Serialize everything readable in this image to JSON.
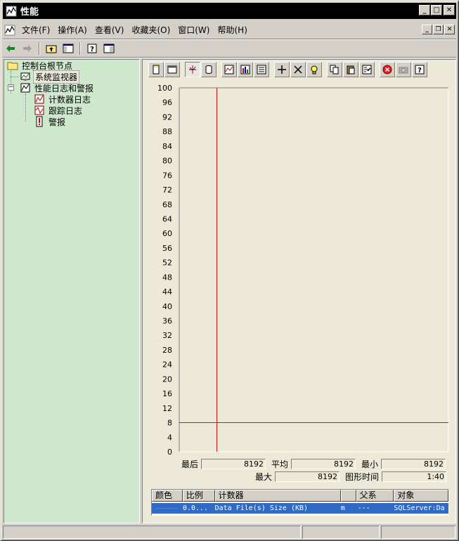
{
  "window": {
    "title": "性能"
  },
  "menu": {
    "items": [
      "文件(F)",
      "操作(A)",
      "查看(V)",
      "收藏夹(O)",
      "窗口(W)",
      "帮助(H)"
    ]
  },
  "tree": {
    "root": "控制台根节点",
    "monitor": "系统监视器",
    "logs": "性能日志和警报",
    "counter_log": "计数器日志",
    "trace_log": "跟踪日志",
    "alert": "警报"
  },
  "stats": {
    "last_label": "最后",
    "last_value": "8192",
    "avg_label": "平均",
    "avg_value": "8192",
    "min_label": "最小",
    "min_value": "8192",
    "max_label": "最大",
    "max_value": "8192",
    "duration_label": "图形时间",
    "duration_value": "1:40"
  },
  "legend": {
    "headers": [
      "颜色",
      "比例",
      "计数器",
      "",
      "父系",
      "对象"
    ],
    "row": {
      "scale": "0.0...",
      "counter": "Data File(s) Size (KB)",
      "instance": "m",
      "parent": "---",
      "object": "SQLServer:Da"
    }
  },
  "chart_data": {
    "type": "line",
    "ylim": [
      0,
      100
    ],
    "y_ticks": [
      "100",
      "96",
      "92",
      "88",
      "84",
      "80",
      "76",
      "72",
      "68",
      "64",
      "60",
      "56",
      "52",
      "48",
      "44",
      "40",
      "36",
      "32",
      "28",
      "24",
      "20",
      "16",
      "12",
      "8",
      "4",
      "0"
    ],
    "series": [
      {
        "name": "Data File(s) Size (KB)",
        "value": 8,
        "color": "#ff0000"
      }
    ],
    "time_bar_fraction": 0.14,
    "grid": false
  },
  "colors": {
    "tree_bg": "#cde8cd",
    "chart_bg": "#ece9d8",
    "series_line": "#cc0000",
    "selection": "#316ac5"
  }
}
